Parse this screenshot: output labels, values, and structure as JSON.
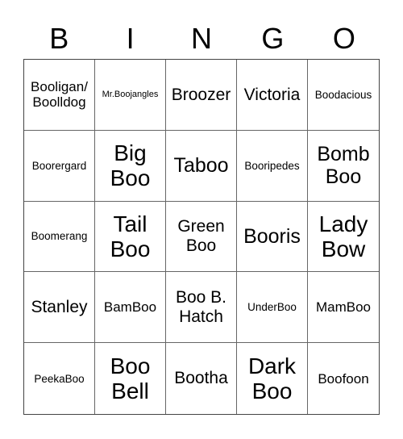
{
  "header": {
    "letters": [
      "B",
      "I",
      "N",
      "G",
      "O"
    ]
  },
  "card": {
    "cells": [
      {
        "text": "Booligan/\nBoolldog",
        "size": "md"
      },
      {
        "text": "Mr.Boojangles",
        "size": "xs"
      },
      {
        "text": "Broozer",
        "size": "lg"
      },
      {
        "text": "Victoria",
        "size": "lg"
      },
      {
        "text": "Boodacious",
        "size": "sm"
      },
      {
        "text": "Boorergard",
        "size": "sm"
      },
      {
        "text": "Big\nBoo",
        "size": "xxl"
      },
      {
        "text": "Taboo",
        "size": "xl"
      },
      {
        "text": "Booripedes",
        "size": "sm"
      },
      {
        "text": "Bomb\nBoo",
        "size": "xl"
      },
      {
        "text": "Boomerang",
        "size": "sm"
      },
      {
        "text": "Tail\nBoo",
        "size": "xxl"
      },
      {
        "text": "Green\nBoo",
        "size": "lg"
      },
      {
        "text": "Booris",
        "size": "xl"
      },
      {
        "text": "Lady\nBow",
        "size": "xxl"
      },
      {
        "text": "Stanley",
        "size": "lg"
      },
      {
        "text": "BamBoo",
        "size": "md"
      },
      {
        "text": "Boo B.\nHatch",
        "size": "lg"
      },
      {
        "text": "UnderBoo",
        "size": "sm"
      },
      {
        "text": "MamBoo",
        "size": "md"
      },
      {
        "text": "PeekaBoo",
        "size": "sm"
      },
      {
        "text": "Boo\nBell",
        "size": "xxl"
      },
      {
        "text": "Bootha",
        "size": "lg"
      },
      {
        "text": "Dark\nBoo",
        "size": "xxl"
      },
      {
        "text": "Boofoon",
        "size": "md"
      }
    ]
  }
}
